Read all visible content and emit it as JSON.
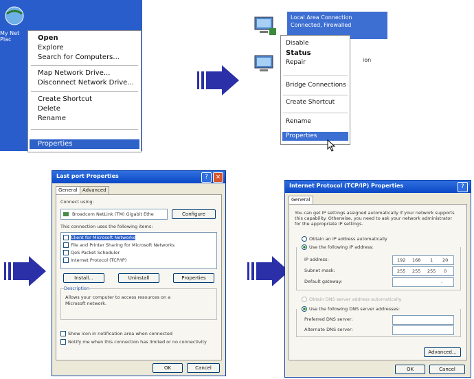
{
  "panel1": {
    "desktop_icon_label": "My Net\nPlac",
    "menu": [
      {
        "label": "Open",
        "bold": true
      },
      {
        "label": "Explore"
      },
      {
        "label": "Search for Computers..."
      },
      {
        "label": "Map Network Drive..."
      },
      {
        "label": "Disconnect Network Drive..."
      },
      {
        "label": "Create Shortcut"
      },
      {
        "label": "Delete"
      },
      {
        "label": "Rename"
      },
      {
        "label": "Properties",
        "selected": true
      }
    ]
  },
  "panel2": {
    "connection": {
      "name": "Local Area Connection",
      "status": "Connected, Firewalled"
    },
    "second_item_fragment": "ion",
    "menu": [
      {
        "label": "Disable"
      },
      {
        "label": "Status",
        "bold": true
      },
      {
        "label": "Repair"
      },
      {
        "label": "Bridge Connections"
      },
      {
        "label": "Create Shortcut"
      },
      {
        "label": "Rename"
      },
      {
        "label": "Properties",
        "selected": true
      }
    ]
  },
  "panel3": {
    "title": "Last port Properties",
    "tabs": [
      "General",
      "Advanced"
    ],
    "connect_using_label": "Connect using:",
    "adapter": "Broadcom NetLink (TM) Gigabit Ethe",
    "configure_button": "Configure",
    "items_label": "This connection uses the following items:",
    "items": [
      {
        "label": "Client for Microsoft Networks",
        "checked": true,
        "selected": true
      },
      {
        "label": "File and Printer Sharing for Microsoft Networks",
        "checked": true
      },
      {
        "label": "QoS Packet Scheduler",
        "checked": true
      },
      {
        "label": "Internet Protocol (TCP/IP)",
        "checked": true
      }
    ],
    "install_button": "Install...",
    "uninstall_button": "Uninstall",
    "properties_button": "Properties",
    "description_label": "Description",
    "description_text": "Allows your computer to access resources on a Microsoft network.",
    "show_icon_label": "Show icon in notification area when connected",
    "notify_label": "Notify me when this connection has limited or no connectivity",
    "ok_button": "OK",
    "cancel_button": "Cancel"
  },
  "panel4": {
    "title": "Internet Protocol (TCP/IP) Properties",
    "tabs": [
      "General"
    ],
    "intro_text": "You can get IP settings assigned automatically if your network supports this capability. Otherwise, you need to ask your network administrator for the appropriate IP settings.",
    "obtain_ip_auto": "Obtain an IP address automatically",
    "use_following_ip": "Use the following IP address:",
    "ip_address_label": "IP address:",
    "ip_address": [
      "192",
      "168",
      "1",
      "20"
    ],
    "subnet_label": "Subnet mask:",
    "subnet_mask": [
      "255",
      "255",
      "255",
      "0"
    ],
    "gateway_label": "Default gateway:",
    "gateway": [
      "",
      "",
      "",
      ""
    ],
    "obtain_dns_auto": "Obtain DNS server address automatically",
    "use_following_dns": "Use the following DNS server addresses:",
    "preferred_dns_label": "Preferred DNS server:",
    "alternate_dns_label": "Alternate DNS server:",
    "advanced_button": "Advanced...",
    "ok_button": "OK",
    "cancel_button": "Cancel"
  },
  "colors": {
    "arrow": "#2b2fa8",
    "xp_blue": "#0b48c6",
    "selection": "#2f62c8"
  }
}
